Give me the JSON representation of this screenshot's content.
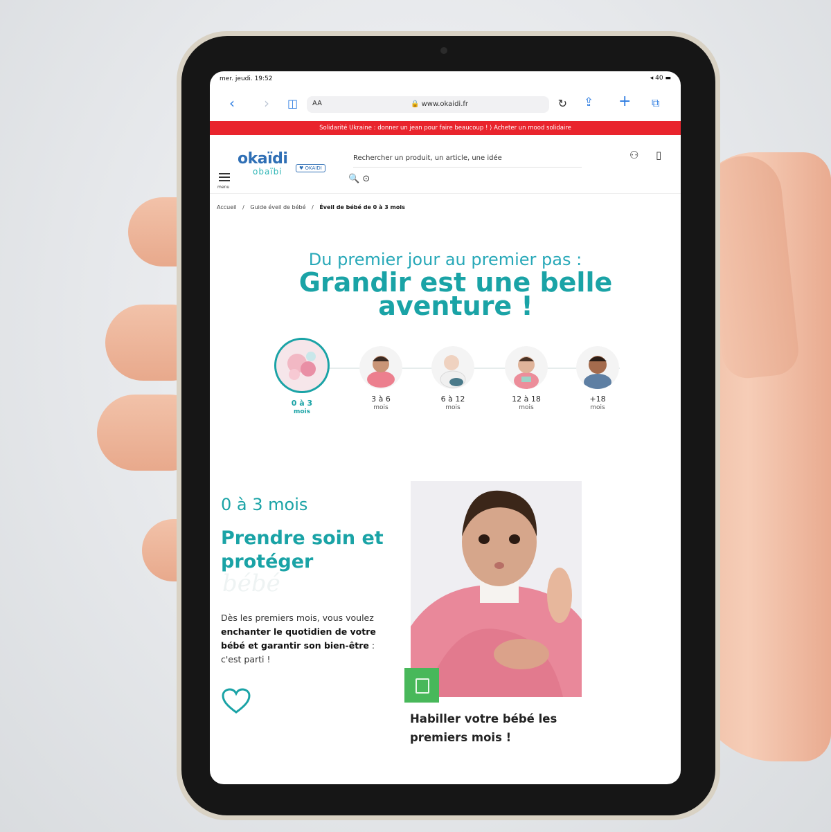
{
  "status_bar": {
    "time": "mer. jeudi. 19:52",
    "indicators": "◂ 40 ▬"
  },
  "browser": {
    "aa_label": "AA",
    "url": "🔒 www.okaidi.fr",
    "icons": [
      "back-icon",
      "forward-icon",
      "sidebar-icon",
      "reload-icon",
      "share-icon",
      "new-tab-icon",
      "tabs-icon"
    ]
  },
  "promo_banner": "Solidarité Ukraine : donner un jean pour faire beaucoup ! ⟩ Acheter un mood solidaire",
  "header": {
    "menu_label": "menu",
    "logo_primary": "okaïdi",
    "logo_secondary": "obaïbi",
    "logo_badge": "♥ OKAIDI",
    "search_placeholder": "Rechercher un produit, un article, une idée",
    "search_icons": "🔍 ⊙"
  },
  "breadcrumb": {
    "home": "Accueil",
    "parent": "Guide éveil de bébé",
    "current": "Éveil de bébé de 0 à 3 mois"
  },
  "hero": {
    "subtitle": "Du premier jour au premier pas :",
    "title": "Grandir est une belle aventure !"
  },
  "timeline": [
    {
      "range": "0 à 3",
      "unit": "mois",
      "active": true
    },
    {
      "range": "3 à 6",
      "unit": "mois",
      "active": false
    },
    {
      "range": "6 à 12",
      "unit": "mois",
      "active": false
    },
    {
      "range": "12 à 18",
      "unit": "mois",
      "active": false
    },
    {
      "range": "+18",
      "unit": "mois",
      "active": false
    }
  ],
  "section": {
    "age": "0 à 3 mois",
    "title": "Prendre soin et protéger",
    "script": "bébé",
    "text_1": "Dès les premiers mois, vous voulez ",
    "text_bold": "enchanter le quotidien de votre bébé et garantir son bien-être",
    "text_2": " : c'est parti !"
  },
  "card": {
    "title": "Habiller votre bébé les premiers mois !"
  },
  "colors": {
    "accent": "#1aa3a6",
    "promo": "#e9242d",
    "ios_blue": "#2f7de1",
    "badge_green": "#48b85a"
  }
}
